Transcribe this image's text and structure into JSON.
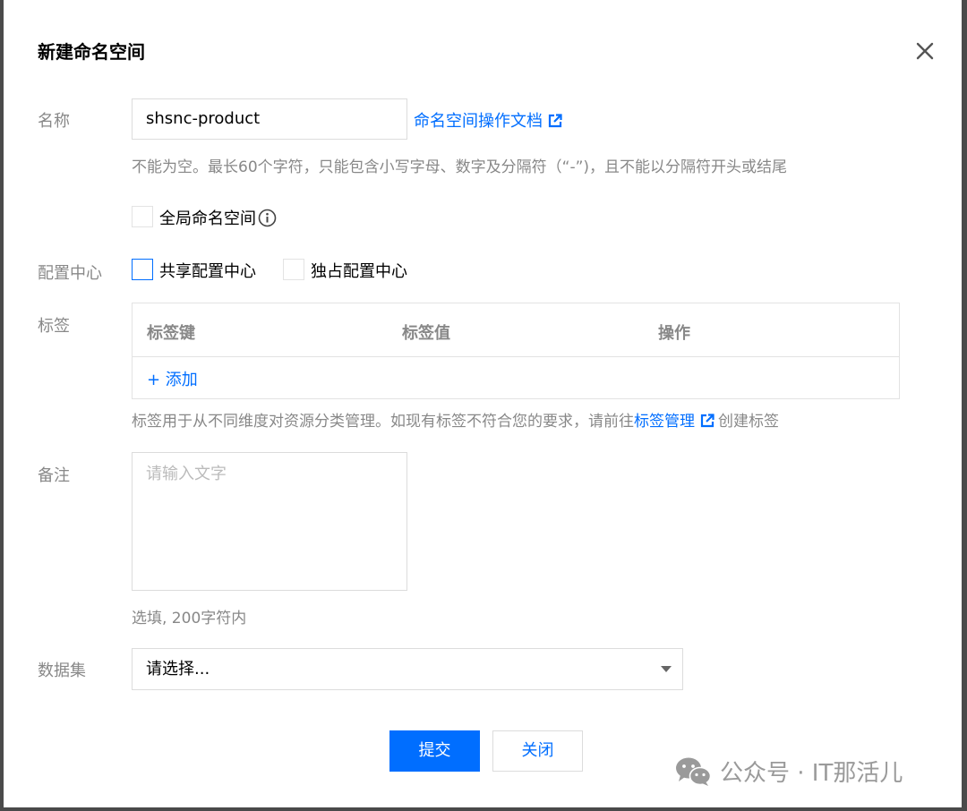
{
  "dialog": {
    "title": "新建命名空间"
  },
  "form": {
    "name": {
      "label": "名称",
      "value": "shsnc-product",
      "doc_link": "命名空间操作文档",
      "hint": "不能为空。最长60个字符，只能包含小写字母、数字及分隔符（“-”)，且不能以分隔符开头或结尾"
    },
    "global_namespace": {
      "label": "全局命名空间",
      "checked": false
    },
    "config_center": {
      "label": "配置中心",
      "options": [
        {
          "label": "共享配置中心",
          "checked": false
        },
        {
          "label": "独占配置中心",
          "checked": false
        }
      ]
    },
    "tags": {
      "label": "标签",
      "columns": [
        "标签键",
        "标签值",
        "操作"
      ],
      "add_label": "+ 添加",
      "hint_prefix": "标签用于从不同维度对资源分类管理。如现有标签不符合您的要求，请前往",
      "hint_link": "标签管理",
      "hint_suffix": "创建标签"
    },
    "remark": {
      "label": "备注",
      "placeholder": "请输入文字",
      "hint": "选填, 200字符内"
    },
    "dataset": {
      "label": "数据集",
      "placeholder": "请选择..."
    }
  },
  "buttons": {
    "submit": "提交",
    "close": "关闭"
  },
  "watermark": {
    "text": "公众号 · IT那活儿"
  },
  "colors": {
    "accent": "#006eff",
    "muted_text": "#888888",
    "border": "#dcdcdc"
  }
}
